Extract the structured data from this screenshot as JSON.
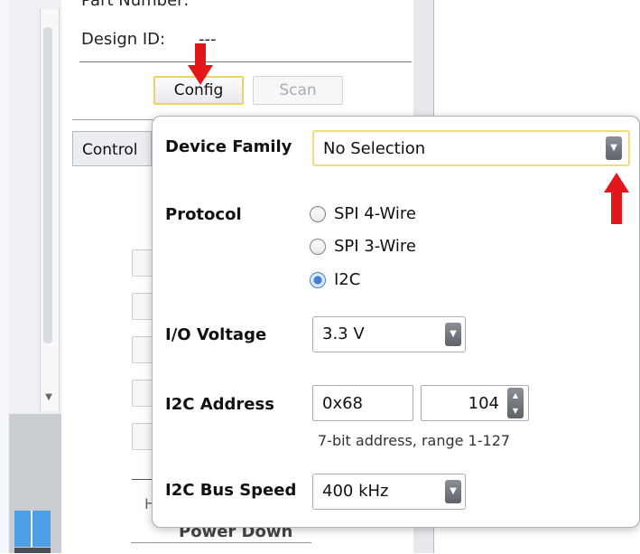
{
  "background": {
    "part_number_label": "Part Number:",
    "design_id_label": "Design ID:",
    "design_id_value": "---",
    "config_label": "Config",
    "scan_label": "Scan",
    "control_tab": "Control",
    "ghost_h": "H",
    "power_down_label": "Power Down"
  },
  "popup": {
    "device_family": {
      "label": "Device Family",
      "value": "No Selection"
    },
    "protocol": {
      "label": "Protocol",
      "options": [
        "SPI 4-Wire",
        "SPI 3-Wire",
        "I2C"
      ],
      "selected": "I2C"
    },
    "io_voltage": {
      "label": "I/O Voltage",
      "value": "3.3 V"
    },
    "i2c_address": {
      "label": "I2C Address",
      "hex_value": "0x68",
      "dec_value": "104",
      "hint": "7-bit address, range 1-127"
    },
    "i2c_bus_speed": {
      "label": "I2C Bus Speed",
      "value": "400 kHz"
    }
  },
  "colors": {
    "annotation_arrow": "#e3161b",
    "focus_border": "#f0dc7a",
    "radio_selected": "#3d7fd6"
  },
  "icons": {
    "select_arrow": "chevron-down-icon",
    "spinner": "spinner-up-down-icon",
    "annotation": "red-arrow-icon"
  }
}
